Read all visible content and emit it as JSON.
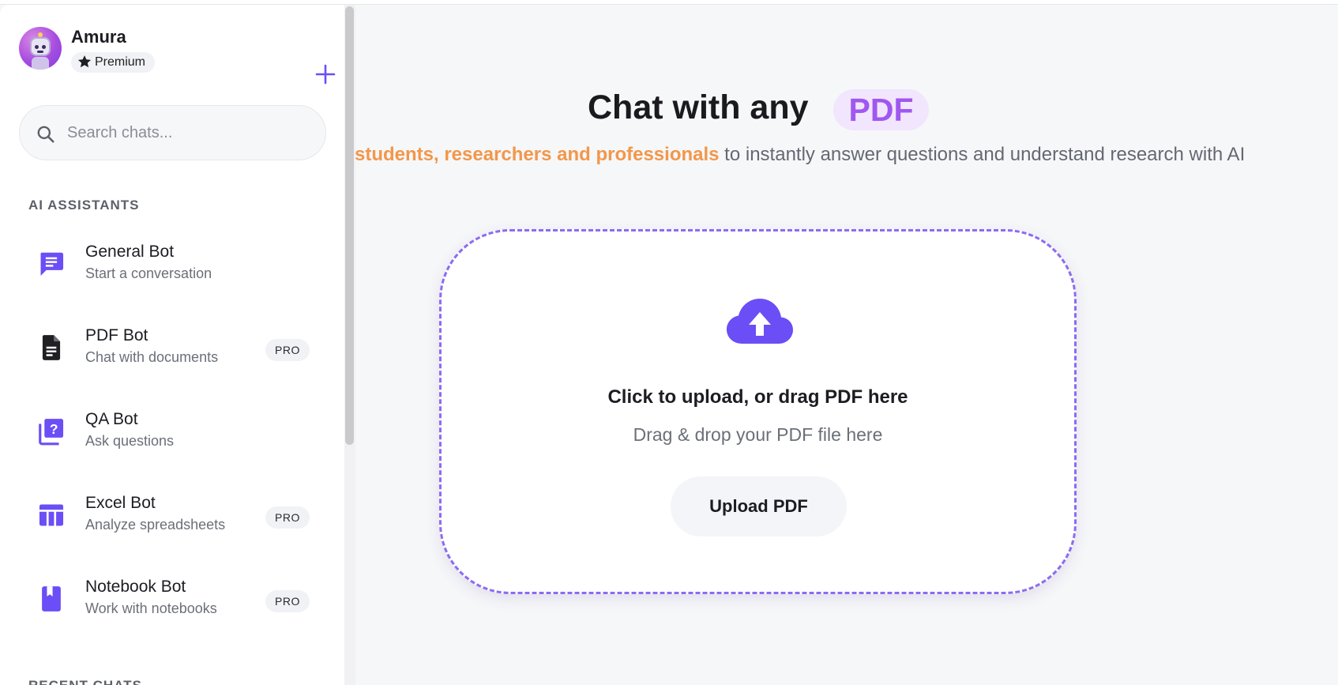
{
  "profile": {
    "name": "Amura",
    "plan": "Premium"
  },
  "search": {
    "placeholder": "Search chats..."
  },
  "sections": {
    "assistants_title": "AI ASSISTANTS",
    "recent_title": "RECENT CHATS"
  },
  "assistants": [
    {
      "name": "General Bot",
      "desc": "Start a conversation",
      "icon": "chat-icon",
      "badge": ""
    },
    {
      "name": "PDF Bot",
      "desc": "Chat with documents",
      "icon": "document-icon",
      "badge": "PRO"
    },
    {
      "name": "QA Bot",
      "desc": "Ask questions",
      "icon": "question-icon",
      "badge": ""
    },
    {
      "name": "Excel Bot",
      "desc": "Analyze spreadsheets",
      "icon": "table-icon",
      "badge": "PRO"
    },
    {
      "name": "Notebook Bot",
      "desc": "Work with notebooks",
      "icon": "notebook-icon",
      "badge": "PRO"
    }
  ],
  "hero": {
    "title": "Chat with any",
    "pill": "PDF",
    "subtitle_highlight": "students, researchers and professionals",
    "subtitle_rest": " to instantly answer questions and understand research with AI"
  },
  "upload": {
    "title": "Click to upload, or drag PDF here",
    "subtitle": "Drag & drop your PDF file here",
    "button": "Upload PDF",
    "icon": "cloud-upload-icon"
  },
  "colors": {
    "accent": "#6b4ef6",
    "pill_bg": "#f1e6fd",
    "pill_text": "#a058f0",
    "highlight": "#f2974a",
    "dashed_border": "#8c6cf0"
  }
}
